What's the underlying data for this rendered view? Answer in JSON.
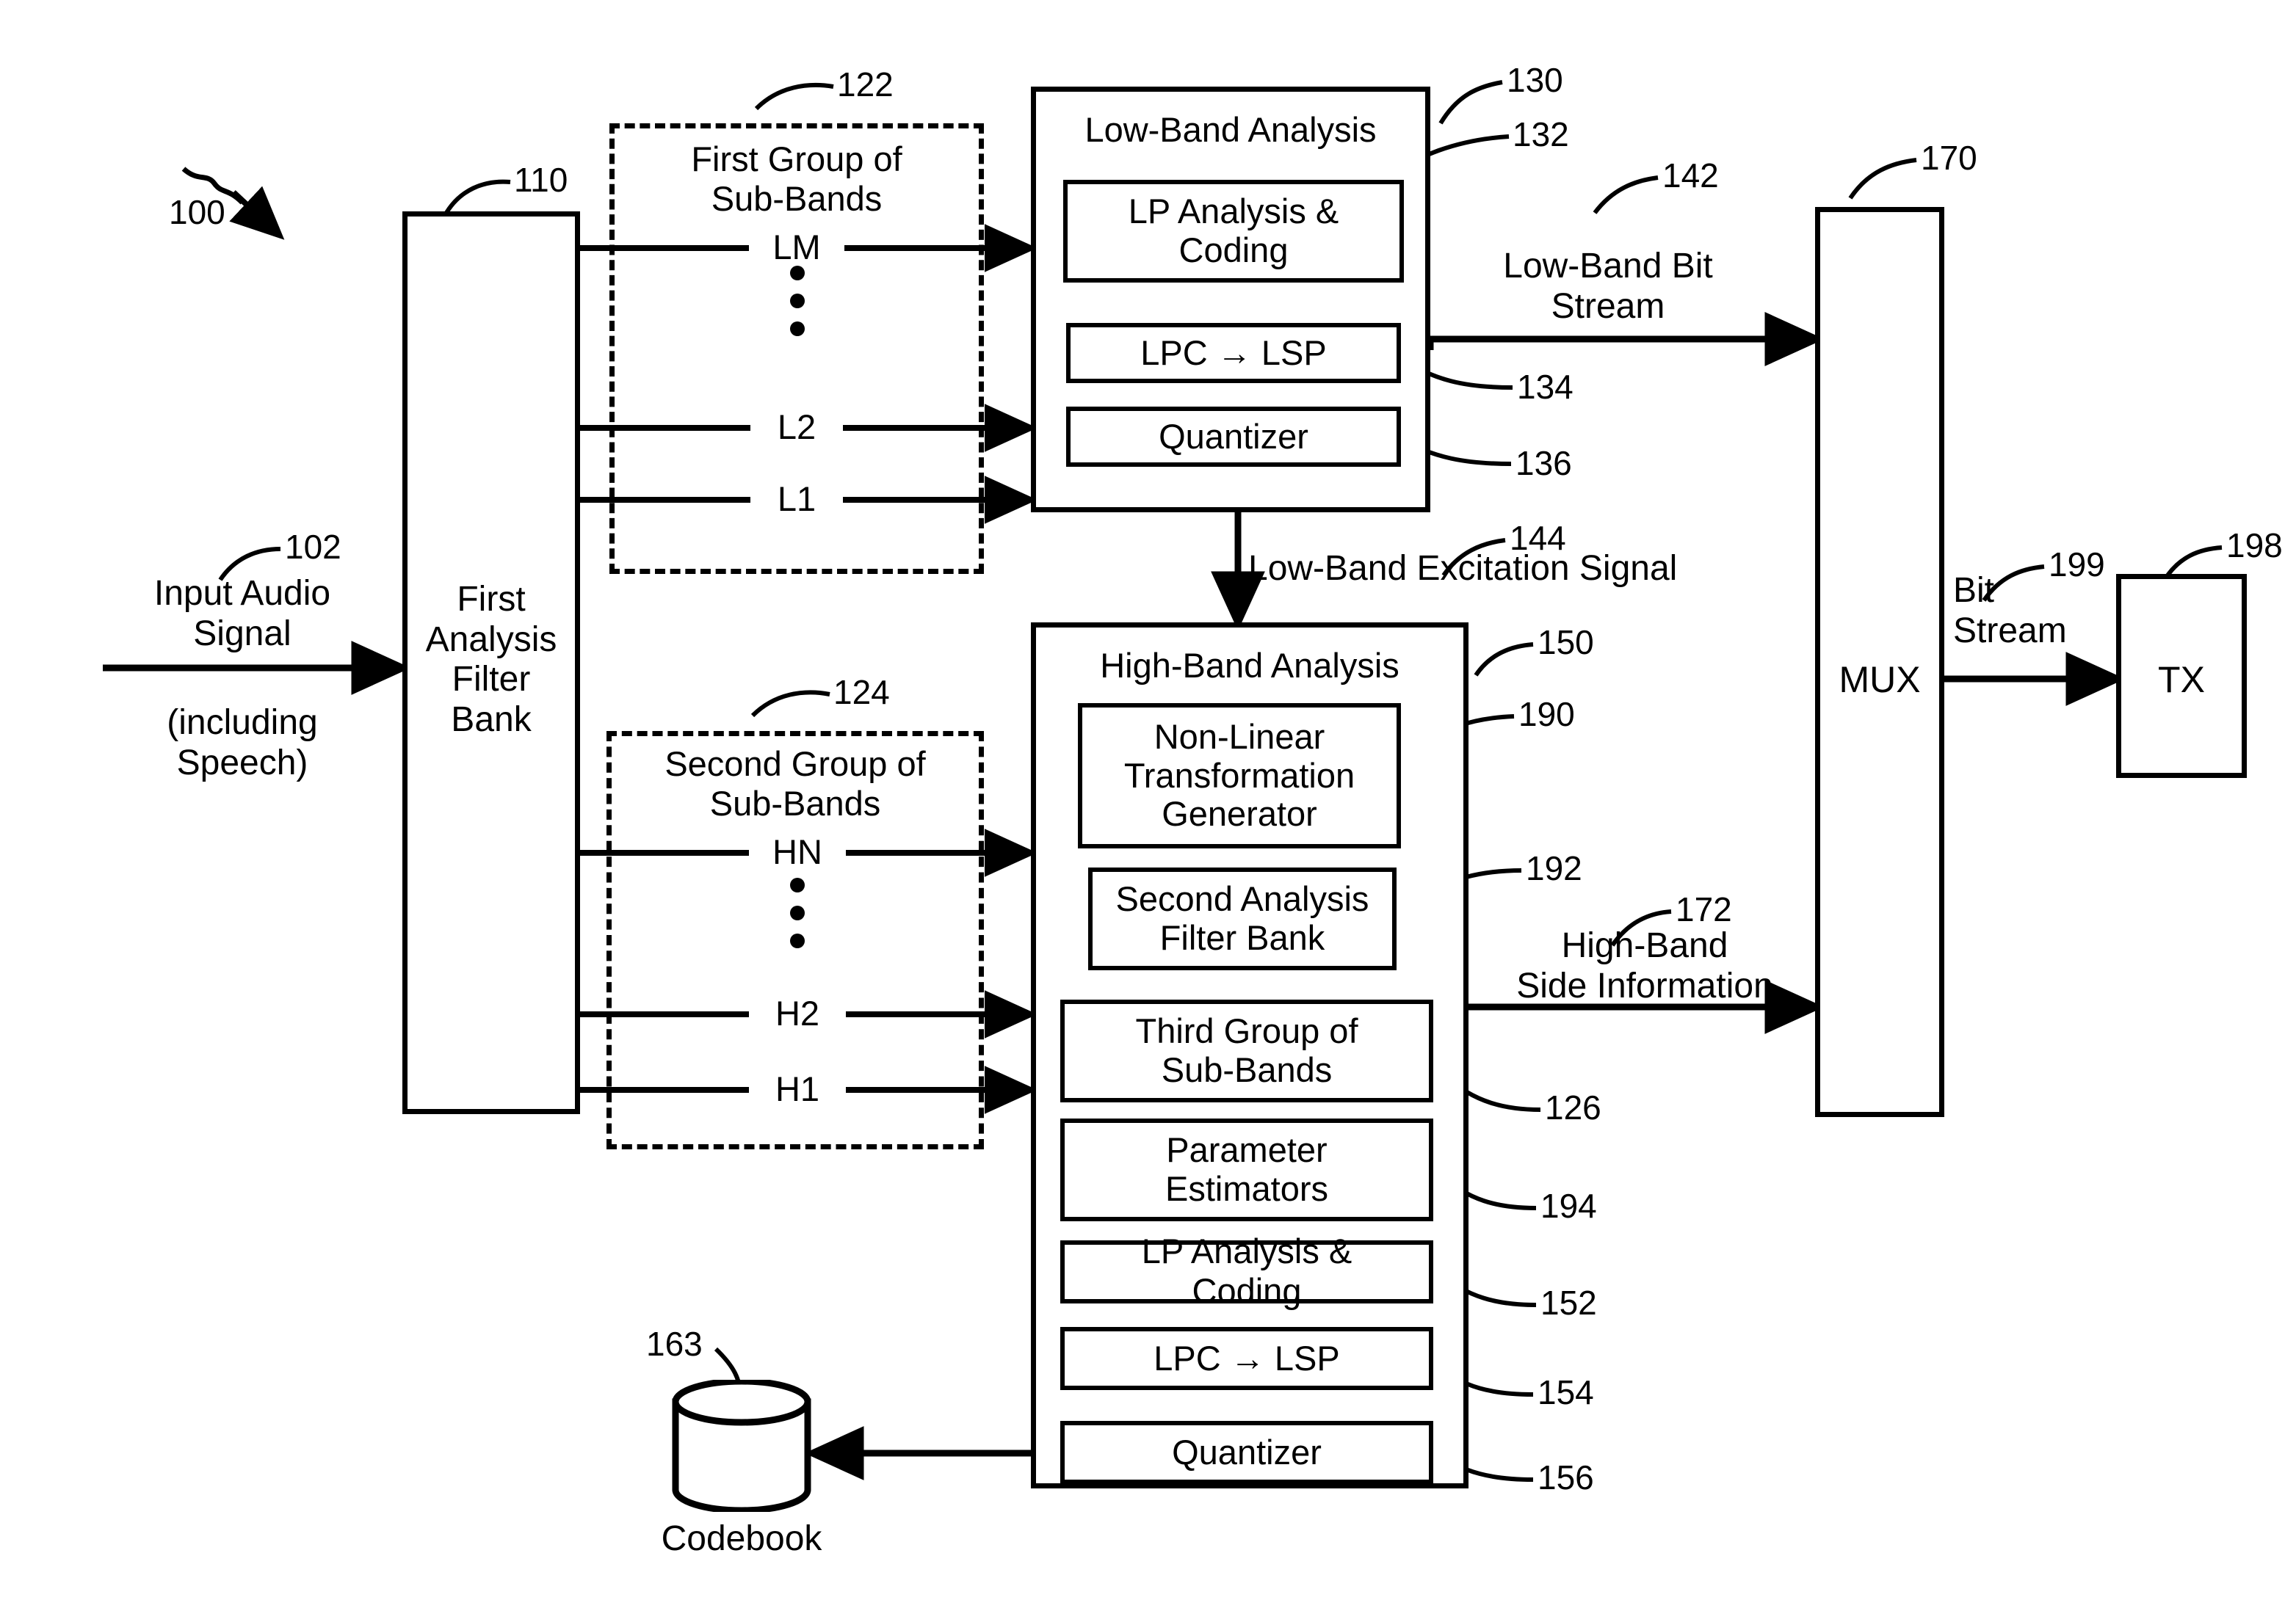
{
  "figure": {
    "system_ref": "100",
    "input": {
      "ref": "102",
      "line1": "Input Audio",
      "line2": "Signal",
      "line3": "(including",
      "line4": "Speech)"
    },
    "first_analysis_filter_bank": {
      "ref": "110",
      "line1": "First",
      "line2": "Analysis",
      "line3": "Filter",
      "line4": "Bank"
    },
    "first_group": {
      "ref": "122",
      "title_line1": "First Group of",
      "title_line2": "Sub-Bands",
      "signals": [
        "LM",
        "L2",
        "L1"
      ],
      "ellipsis": "vertical-dots"
    },
    "second_group": {
      "ref": "124",
      "title_line1": "Second Group of",
      "title_line2": "Sub-Bands",
      "signals": [
        "HN",
        "H2",
        "H1"
      ],
      "ellipsis": "vertical-dots"
    },
    "low_band_analysis": {
      "ref": "130",
      "title": "Low-Band Analysis",
      "blocks": [
        {
          "ref": "132",
          "line1": "LP Analysis &",
          "line2": "Coding"
        },
        {
          "ref": "134",
          "line1": "LPC → LSP",
          "line2": ""
        },
        {
          "ref": "136",
          "line1": "Quantizer",
          "line2": ""
        }
      ]
    },
    "high_band_analysis": {
      "ref": "150",
      "title": "High-Band Analysis",
      "blocks": [
        {
          "ref": "190",
          "line1": "Non-Linear",
          "line2": "Transformation",
          "line3": "Generator"
        },
        {
          "ref": "192",
          "line1": "Second Analysis",
          "line2": "Filter Bank",
          "line3": ""
        },
        {
          "ref": "126",
          "line1": "Third Group of",
          "line2": "Sub-Bands",
          "line3": ""
        },
        {
          "ref": "194",
          "line1": "Parameter",
          "line2": "Estimators",
          "line3": ""
        },
        {
          "ref": "152",
          "line1": "LP Analysis &",
          "line2": "Coding",
          "line3": ""
        },
        {
          "ref": "154",
          "line1": "LPC → LSP",
          "line2": "",
          "line3": ""
        },
        {
          "ref": "156",
          "line1": "Quantizer",
          "line2": "",
          "line3": ""
        }
      ]
    },
    "codebook": {
      "ref": "163",
      "label": "Codebook"
    },
    "signals": {
      "low_band_bit_stream": {
        "ref": "142",
        "line1": "Low-Band Bit",
        "line2": "Stream"
      },
      "low_band_excitation": {
        "ref": "144",
        "label": "Low-Band Excitation Signal"
      },
      "high_band_side_info": {
        "ref": "172",
        "line1": "High-Band",
        "line2": "Side Information"
      },
      "bit_stream": {
        "ref": "199",
        "line1": "Bit",
        "line2": "Stream"
      }
    },
    "mux": {
      "ref": "170",
      "label": "MUX"
    },
    "tx": {
      "ref": "198",
      "label": "TX"
    }
  },
  "colors": {
    "stroke": "#000000",
    "background": "#ffffff"
  }
}
